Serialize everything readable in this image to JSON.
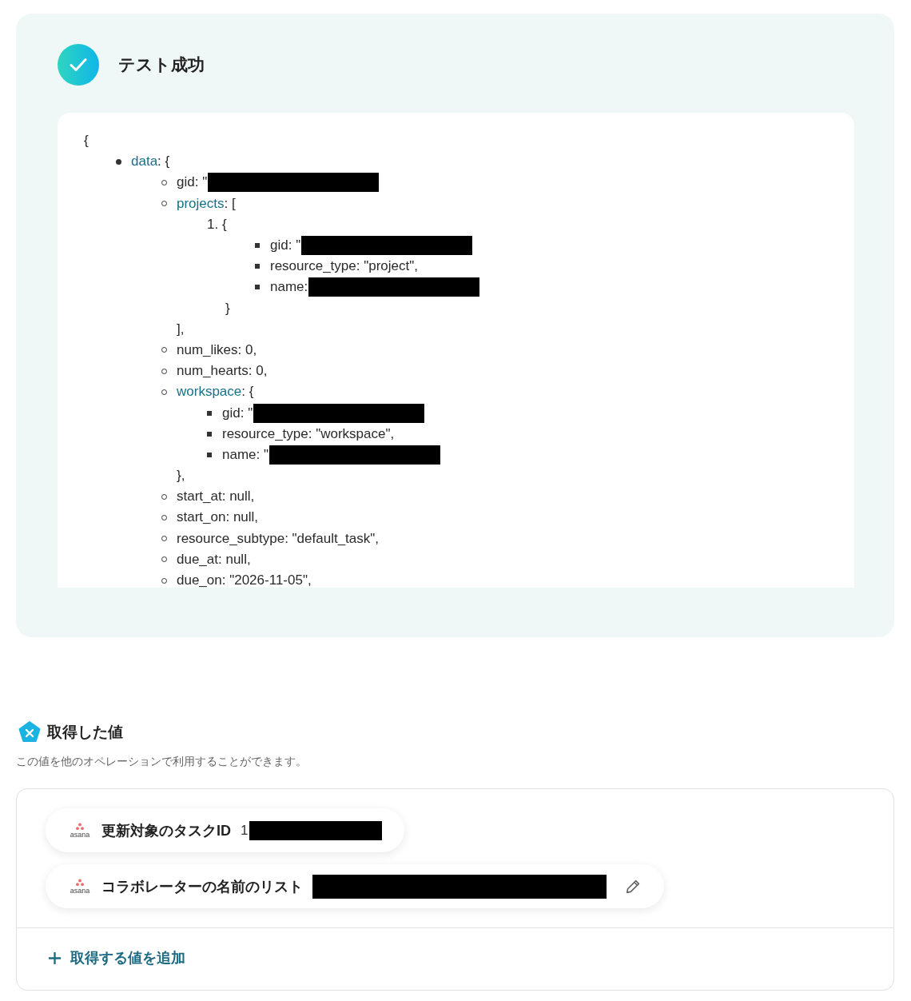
{
  "result": {
    "title": "テスト成功",
    "output": {
      "open": "{",
      "nodes": [
        {
          "kind": "disc",
          "key": "data",
          "link": true,
          "rest": ": {",
          "redacted": false,
          "children": [
            {
              "kind": "circle",
              "key": "gid",
              "link": false,
              "rest": ": \"",
              "redacted": true
            },
            {
              "kind": "circle",
              "key": "projects",
              "link": true,
              "rest": ": [",
              "redacted": false,
              "close": "],",
              "children": [
                {
                  "kind": "number",
                  "key": "1.",
                  "rest": " {",
                  "redacted": false,
                  "close": "}",
                  "children": [
                    {
                      "kind": "square",
                      "key": "gid",
                      "link": false,
                      "rest": ": \"",
                      "redacted": true
                    },
                    {
                      "kind": "square",
                      "key": "resource_type",
                      "link": false,
                      "rest": ": \"project\",",
                      "redacted": false
                    },
                    {
                      "kind": "square",
                      "key": "name",
                      "link": false,
                      "rest": ":",
                      "redacted": true
                    }
                  ]
                }
              ]
            },
            {
              "kind": "circle",
              "key": "num_likes",
              "link": false,
              "rest": ": 0,",
              "redacted": false
            },
            {
              "kind": "circle",
              "key": "num_hearts",
              "link": false,
              "rest": ": 0,",
              "redacted": false
            },
            {
              "kind": "circle",
              "key": "workspace",
              "link": true,
              "rest": ": {",
              "redacted": false,
              "close": "},",
              "children": [
                {
                  "kind": "square",
                  "key": "gid",
                  "link": false,
                  "rest": ": \"",
                  "redacted": true
                },
                {
                  "kind": "square",
                  "key": "resource_type",
                  "link": false,
                  "rest": ": \"workspace\",",
                  "redacted": false
                },
                {
                  "kind": "square",
                  "key": "name",
                  "link": false,
                  "rest": ": \"",
                  "redacted": true
                }
              ]
            },
            {
              "kind": "circle",
              "key": "start_at",
              "link": false,
              "rest": ": null,",
              "redacted": false
            },
            {
              "kind": "circle",
              "key": "start_on",
              "link": false,
              "rest": ": null,",
              "redacted": false
            },
            {
              "kind": "circle",
              "key": "resource_subtype",
              "link": false,
              "rest": ": \"default_task\",",
              "redacted": false
            },
            {
              "kind": "circle",
              "key": "due_at",
              "link": false,
              "rest": ": null,",
              "redacted": false
            },
            {
              "kind": "circle",
              "key": "due_on",
              "link": false,
              "rest": ": \"2026-11-05\",",
              "redacted": false
            }
          ]
        }
      ]
    }
  },
  "values": {
    "title": "取得した値",
    "description": "この値を他のオペレーションで利用することができます。",
    "items": [
      {
        "app": "asana",
        "label": "更新対象のタスクID",
        "value": "1",
        "redacted": true,
        "editable": false
      },
      {
        "app": "asana",
        "label": "コラボレーターの名前のリスト",
        "redacted": true,
        "editable": true
      }
    ],
    "add_label": "取得する値を追加"
  }
}
